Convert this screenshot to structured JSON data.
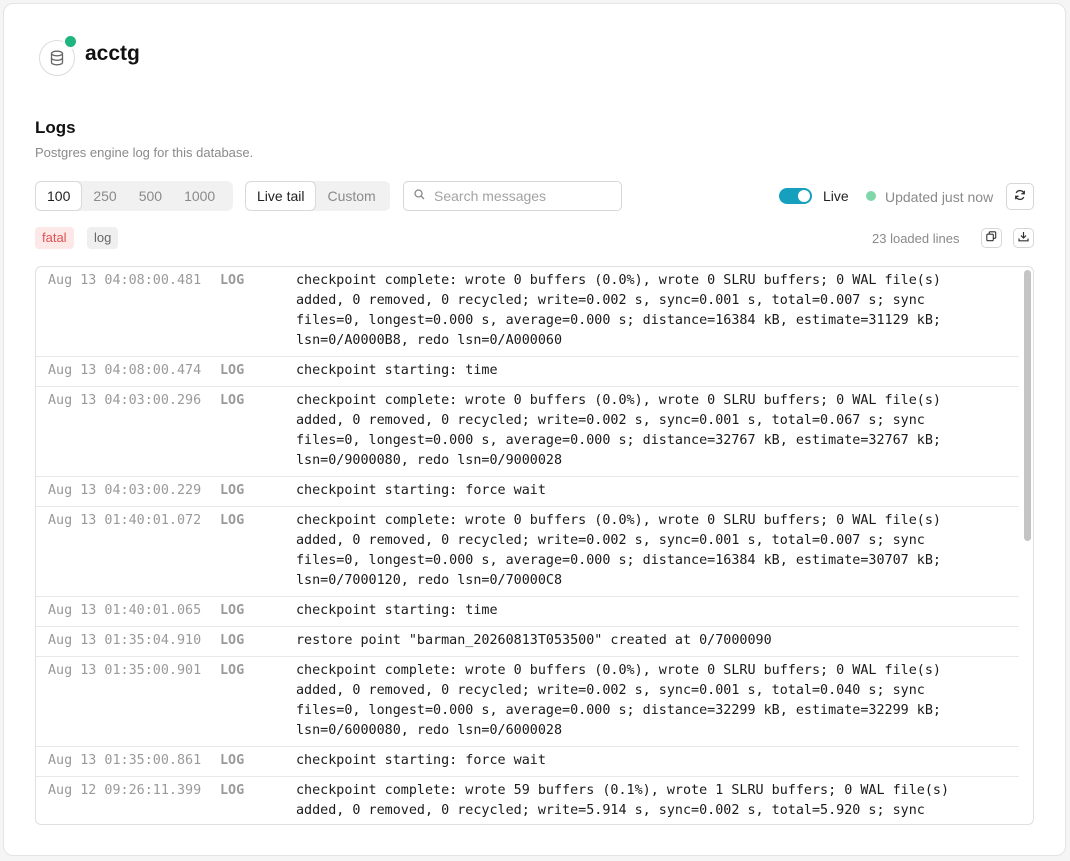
{
  "database": {
    "name": "acctg",
    "status_color": "#1fb57f"
  },
  "logs": {
    "title": "Logs",
    "subtitle": "Postgres engine log for this database."
  },
  "line_count_options": [
    "100",
    "250",
    "500",
    "1000"
  ],
  "line_count_selected": "100",
  "mode_options": [
    "Live tail",
    "Custom"
  ],
  "mode_selected": "Live tail",
  "search": {
    "placeholder": "Search messages",
    "value": ""
  },
  "live": {
    "label": "Live",
    "enabled": true,
    "updated_text": "Updated just now"
  },
  "level_tags": [
    "fatal",
    "log"
  ],
  "loaded_text": "23 loaded lines",
  "icons": {
    "database": "database-icon",
    "search": "search-icon",
    "refresh": "refresh-icon",
    "copy": "copy-icon",
    "download": "download-icon"
  },
  "rows": [
    {
      "timestamp": "Aug 13 04:08:00.481",
      "level": "LOG",
      "message": "checkpoint complete: wrote 0 buffers (0.0%), wrote 0 SLRU buffers; 0 WAL file(s)\nadded, 0 removed, 0 recycled; write=0.002 s, sync=0.001 s, total=0.007 s; sync\nfiles=0, longest=0.000 s, average=0.000 s; distance=16384 kB, estimate=31129 kB;\nlsn=0/A0000B8, redo lsn=0/A000060"
    },
    {
      "timestamp": "Aug 13 04:08:00.474",
      "level": "LOG",
      "message": "checkpoint starting: time"
    },
    {
      "timestamp": "Aug 13 04:03:00.296",
      "level": "LOG",
      "message": "checkpoint complete: wrote 0 buffers (0.0%), wrote 0 SLRU buffers; 0 WAL file(s)\nadded, 0 removed, 0 recycled; write=0.002 s, sync=0.001 s, total=0.067 s; sync\nfiles=0, longest=0.000 s, average=0.000 s; distance=32767 kB, estimate=32767 kB;\nlsn=0/9000080, redo lsn=0/9000028"
    },
    {
      "timestamp": "Aug 13 04:03:00.229",
      "level": "LOG",
      "message": "checkpoint starting: force wait"
    },
    {
      "timestamp": "Aug 13 01:40:01.072",
      "level": "LOG",
      "message": "checkpoint complete: wrote 0 buffers (0.0%), wrote 0 SLRU buffers; 0 WAL file(s)\nadded, 0 removed, 0 recycled; write=0.002 s, sync=0.001 s, total=0.007 s; sync\nfiles=0, longest=0.000 s, average=0.000 s; distance=16384 kB, estimate=30707 kB;\nlsn=0/7000120, redo lsn=0/70000C8"
    },
    {
      "timestamp": "Aug 13 01:40:01.065",
      "level": "LOG",
      "message": "checkpoint starting: time"
    },
    {
      "timestamp": "Aug 13 01:35:04.910",
      "level": "LOG",
      "message": "restore point \"barman_20260813T053500\" created at 0/7000090"
    },
    {
      "timestamp": "Aug 13 01:35:00.901",
      "level": "LOG",
      "message": "checkpoint complete: wrote 0 buffers (0.0%), wrote 0 SLRU buffers; 0 WAL file(s)\nadded, 0 removed, 0 recycled; write=0.002 s, sync=0.001 s, total=0.040 s; sync\nfiles=0, longest=0.000 s, average=0.000 s; distance=32299 kB, estimate=32299 kB;\nlsn=0/6000080, redo lsn=0/6000028"
    },
    {
      "timestamp": "Aug 13 01:35:00.861",
      "level": "LOG",
      "message": "checkpoint starting: force wait"
    },
    {
      "timestamp": "Aug 12 09:26:11.399",
      "level": "LOG",
      "message": "checkpoint complete: wrote 59 buffers (0.1%), wrote 1 SLRU buffers; 0 WAL file(s)\nadded, 0 removed, 0 recycled; write=5.914 s, sync=0.002 s, total=5.920 s; sync"
    }
  ]
}
